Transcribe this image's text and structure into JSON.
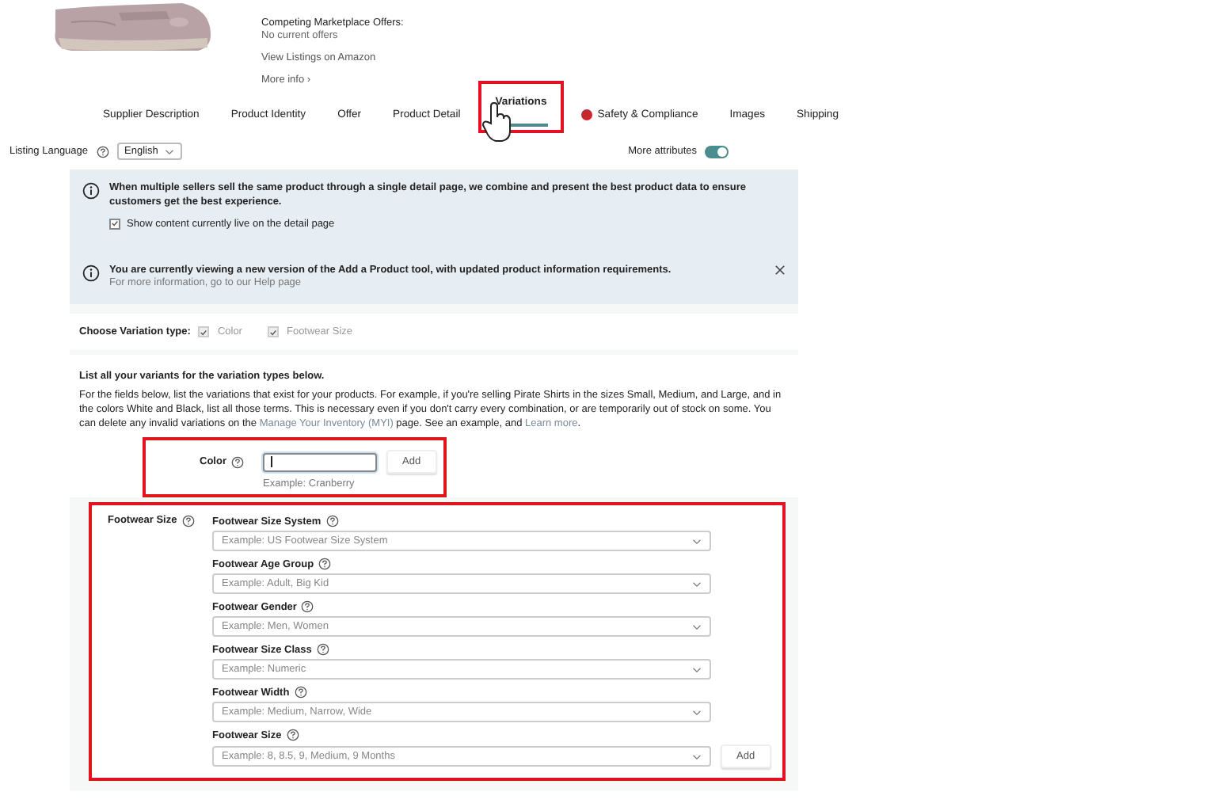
{
  "product": {
    "offers_label": "Competing Marketplace Offers:",
    "offers_value": "No current offers",
    "view_link": "View Listings on Amazon",
    "more_info": "More info",
    "more_info_icon": "›"
  },
  "tabs": [
    {
      "label": "Supplier Description",
      "selected": false,
      "alert": false,
      "highlighted": false
    },
    {
      "label": "Product Identity",
      "selected": false,
      "alert": false,
      "highlighted": false
    },
    {
      "label": "Offer",
      "selected": false,
      "alert": false,
      "highlighted": false
    },
    {
      "label": "Product Detail",
      "selected": false,
      "alert": false,
      "highlighted": false
    },
    {
      "label": "Variations",
      "selected": true,
      "alert": false,
      "highlighted": true
    },
    {
      "label": "Safety & Compliance",
      "selected": false,
      "alert": true,
      "highlighted": false
    },
    {
      "label": "Images",
      "selected": false,
      "alert": false,
      "highlighted": false
    },
    {
      "label": "Shipping",
      "selected": false,
      "alert": false,
      "highlighted": false
    }
  ],
  "listing_language": {
    "label": "Listing Language",
    "value": "English"
  },
  "more_attributes": {
    "label": "More attributes",
    "on": true
  },
  "notices": [
    {
      "text": "When multiple sellers sell the same product through a single detail page, we combine and present the best product data to ensure customers get the best experience.",
      "checkbox": {
        "label": "Show content currently live on the detail page",
        "checked": true
      },
      "dismissible": false
    },
    {
      "text": "You are currently viewing a new version of the Add a Product tool, with updated product information requirements.",
      "subtext": "For more information, go to our Help page",
      "dismissible": true
    }
  ],
  "variation_types": {
    "label": "Choose Variation type:",
    "options": [
      {
        "label": "Color",
        "checked": true
      },
      {
        "label": "Footwear Size",
        "checked": true
      }
    ]
  },
  "variants": {
    "heading": "List all your variants for the variation types below.",
    "description": [
      {
        "text": "For the fields below, list the variations that exist for your products. For example, if you're selling Pirate Shirts in the sizes Small, Medium, and Large, and in the colors White and Black, list all those terms. This is necessary even if you don't carry every combination, or are temporarily out of stock on some. You can delete any invalid variations on the ",
        "link": false
      },
      {
        "text": "Manage Your Inventory (MYI)",
        "link": true
      },
      {
        "text": " page. See an example, and ",
        "link": false
      },
      {
        "text": "Learn more",
        "link": true
      },
      {
        "text": ".",
        "link": false
      }
    ]
  },
  "color_field": {
    "label": "Color",
    "hint": "Example: Cranberry",
    "button": "Add",
    "focused": true,
    "highlighted": true
  },
  "footwear_size": {
    "label": "Footwear Size",
    "highlighted": true,
    "button": "Add",
    "fields": [
      {
        "label": "Footwear Size System",
        "placeholder": "Example: US Footwear Size System"
      },
      {
        "label": "Footwear Age Group",
        "placeholder": "Example: Adult, Big Kid"
      },
      {
        "label": "Footwear Gender",
        "placeholder": "Example: Men, Women"
      },
      {
        "label": "Footwear Size Class",
        "placeholder": "Example: Numeric"
      },
      {
        "label": "Footwear Width",
        "placeholder": "Example: Medium, Narrow, Wide"
      },
      {
        "label": "Footwear Size",
        "placeholder": "Example: 8, 8.5, 9, Medium, 9 Months"
      }
    ]
  }
}
